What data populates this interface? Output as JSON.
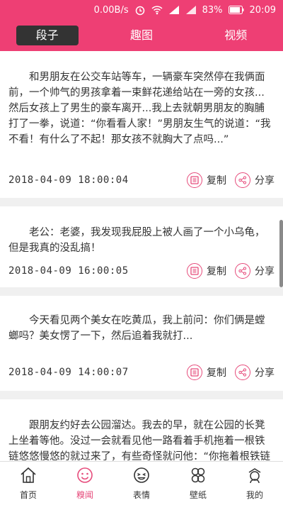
{
  "status": {
    "speed": "0.00B/s",
    "battery": "83%",
    "time": "20:09"
  },
  "tabs": [
    {
      "label": "段子",
      "active": true
    },
    {
      "label": "趣图",
      "active": false
    },
    {
      "label": "视频",
      "active": false
    }
  ],
  "posts": [
    {
      "text": "和男朋友在公交车站等车，一辆豪车突然停在我俩面前，一个帅气的男孩拿着一束鲜花递给站在一旁的女孩...然后女孩上了男生的豪车离开...我上去就朝男朋友的胸脯打了一拳，说道：“你看看人家！”男朋友生气的说道：“我不看！有什么了不起！那女孩不就胸大了点吗...”",
      "date": "2018-04-09  18:00:04"
    },
    {
      "text": "老公：老婆，我发现我屁股上被人画了一个小乌龟，但是我真的没乱搞！",
      "date": "2018-04-09  16:00:05"
    },
    {
      "text": "今天看见两个美女在吃黄瓜，我上前问：你们俩是螳螂吗？美女愣了一下，然后追着我就打...",
      "date": "2018-04-09  14:00:07"
    },
    {
      "text": "跟朋友约好去公园溜达。我去的早，就在公园的长凳上坐着等他。没过一会就看见他一路看着手机拖着一根铁链悠悠慢悠的就过来了，有些奇怪就问他：“你拖着根铁链干啥？”",
      "date": ""
    }
  ],
  "actions": {
    "copy": "复制",
    "share": "分享"
  },
  "nav": [
    {
      "label": "首页",
      "icon": "home-icon",
      "active": false
    },
    {
      "label": "糗闻",
      "icon": "smiley-icon",
      "active": true
    },
    {
      "label": "表情",
      "icon": "emoji-icon",
      "active": false
    },
    {
      "label": "壁纸",
      "icon": "wallpaper-icon",
      "active": false
    },
    {
      "label": "我的",
      "icon": "profile-icon",
      "active": false
    }
  ],
  "colors": {
    "accent": "#ee3f74",
    "tab_active_bg": "#333333"
  }
}
